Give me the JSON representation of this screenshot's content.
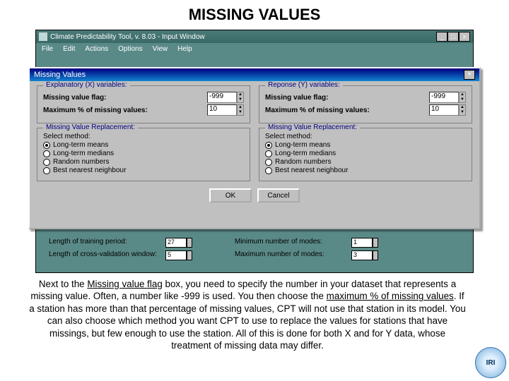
{
  "slide": {
    "title": "MISSING VALUES"
  },
  "app": {
    "title": "Climate Predictability Tool, v. 8.03 - Input Window",
    "menu": [
      "File",
      "Edit",
      "Actions",
      "Options",
      "View",
      "Help"
    ]
  },
  "dialog": {
    "title": "Missing Values",
    "x_legend": "Explanatory (X) variables:",
    "y_legend": "Reponse (Y) variables:",
    "flag_label": "Missing value flag:",
    "max_label": "Maximum % of missing values:",
    "x_flag": "-999",
    "x_max": "10",
    "y_flag": "-999",
    "y_max": "10",
    "repl_legend": "Missing Value Replacement:",
    "select_label": "Select method:",
    "methods": [
      "Long-term means",
      "Long-term medians",
      "Random numbers",
      "Best nearest neighbour"
    ],
    "ok": "OK",
    "cancel": "Cancel"
  },
  "bg": {
    "train_len_label": "Length of training period:",
    "train_len": "27",
    "cv_len_label": "Length of cross-validation window:",
    "cv_len": "5",
    "min_modes_label": "Minimum number of modes:",
    "min_modes": "1",
    "max_modes_label": "Maximum number of modes:",
    "max_modes": "3"
  },
  "caption": {
    "p1a": "Next to the ",
    "p1u": "Missing value flag",
    "p1b": " box, you need to specify the number in your dataset that represents a missing value. Often, a number like -999 is used. You then choose the ",
    "p1u2": "maximum % of missing values",
    "p1c": ". If a station has more than that percentage of missing values, CPT will not use that station in its model. You can also choose which method you want CPT to use to replace the values for stations that have missings, but few enough to use the station. All of this is done for both X and for Y data, whose treatment of missing data may differ."
  },
  "logo": "IRI"
}
